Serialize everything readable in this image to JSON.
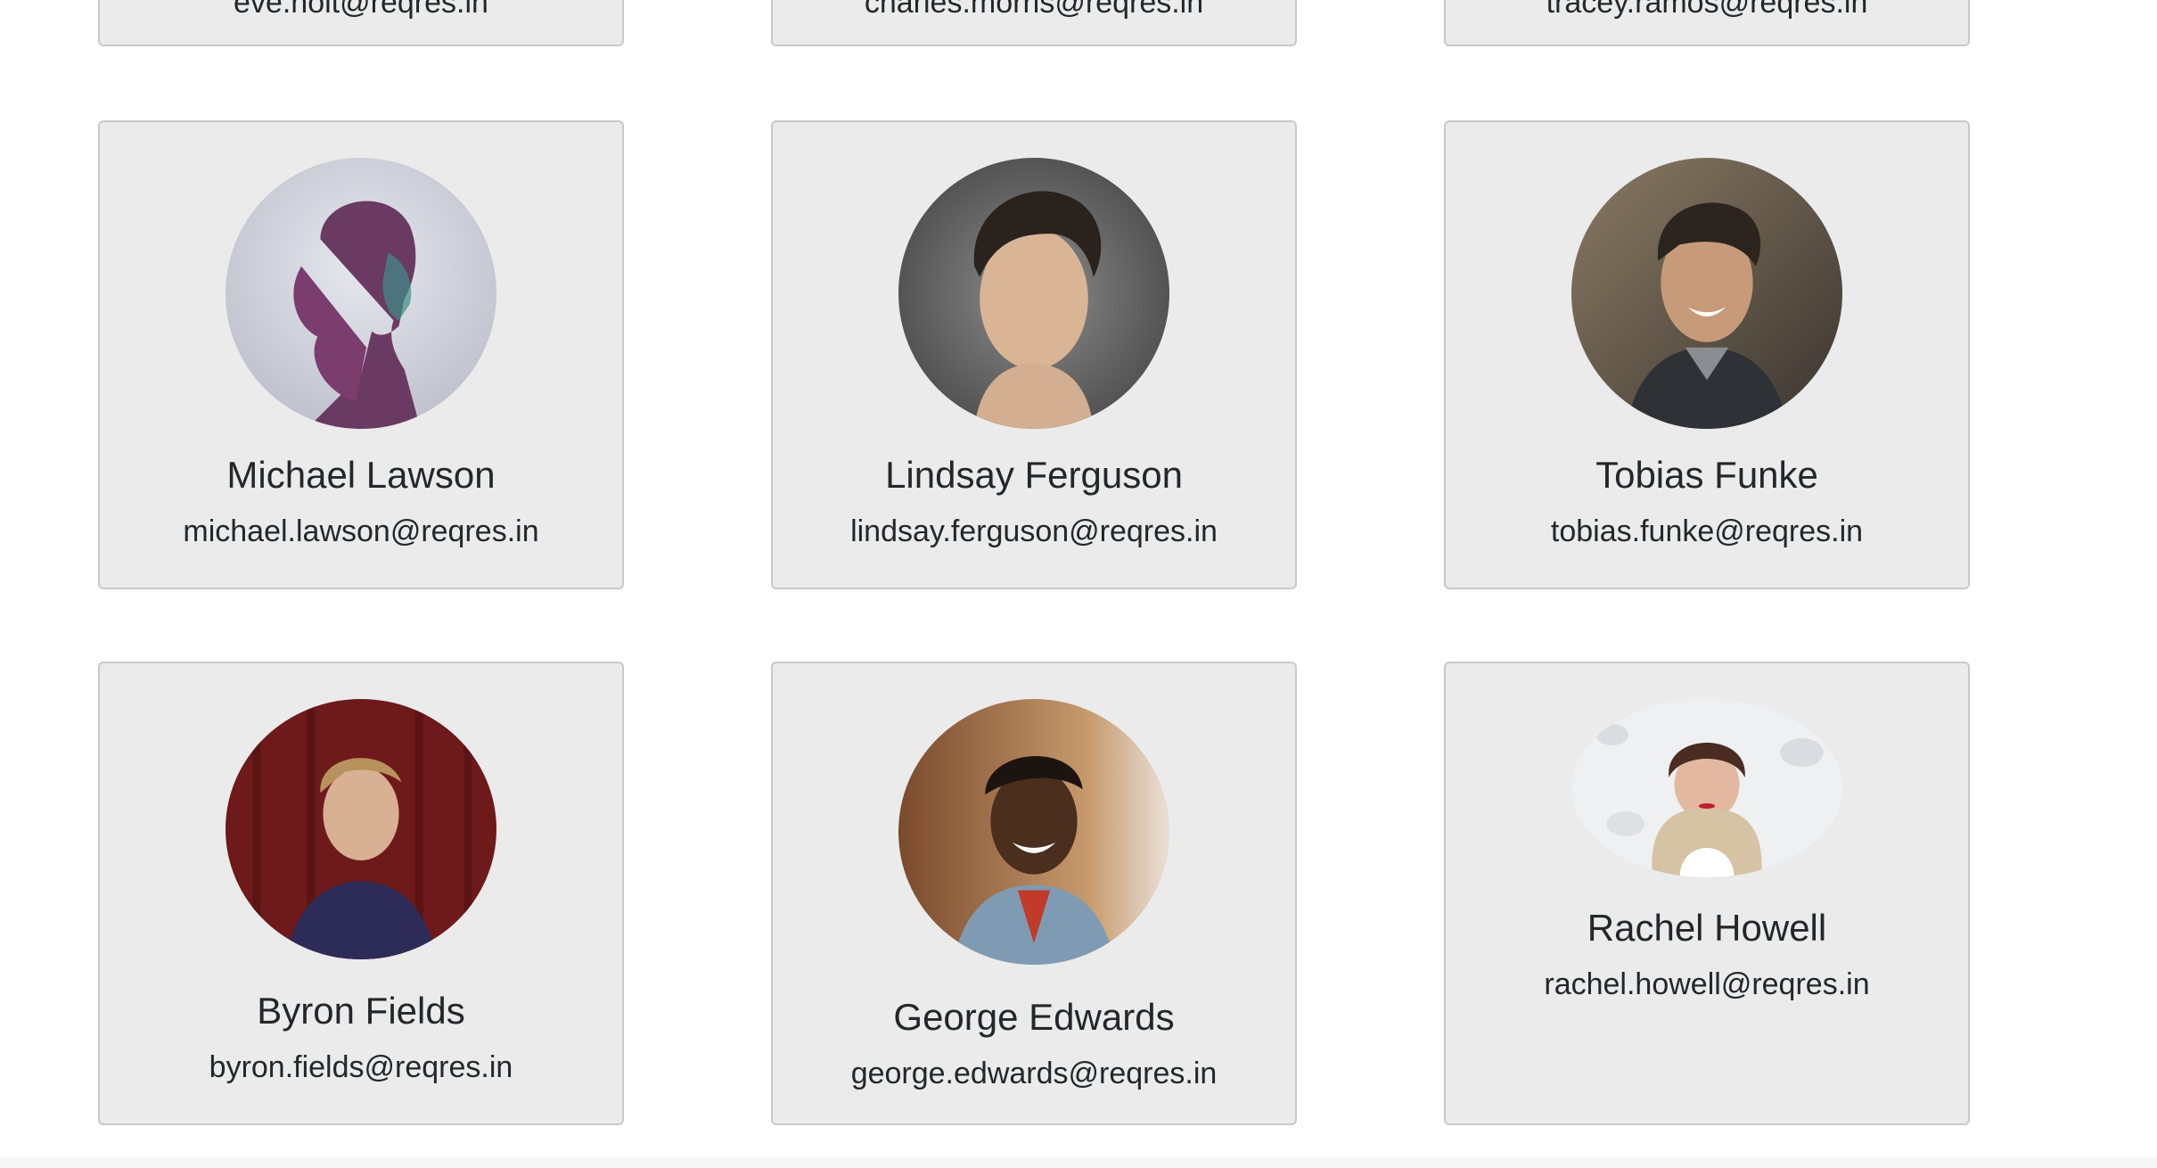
{
  "users_top_row": [
    {
      "email": "eve.holt@reqres.in"
    },
    {
      "email": "charles.morris@reqres.in"
    },
    {
      "email": "tracey.ramos@reqres.in"
    }
  ],
  "users": [
    {
      "name": "Michael Lawson",
      "email": "michael.lawson@reqres.in",
      "avatar_icon": "avatar-woman-purple-profile"
    },
    {
      "name": "Lindsay Ferguson",
      "email": "lindsay.ferguson@reqres.in",
      "avatar_icon": "avatar-young-man-portrait"
    },
    {
      "name": "Tobias Funke",
      "email": "tobias.funke@reqres.in",
      "avatar_icon": "avatar-smiling-man"
    },
    {
      "name": "Byron Fields",
      "email": "byron.fields@reqres.in",
      "avatar_icon": "avatar-man-red-background"
    },
    {
      "name": "George Edwards",
      "email": "george.edwards@reqres.in",
      "avatar_icon": "avatar-man-street"
    },
    {
      "name": "Rachel Howell",
      "email": "rachel.howell@reqres.in",
      "avatar_icon": "avatar-woman-snow"
    }
  ],
  "colors": {
    "card_bg": "#ebebeb",
    "card_border": "#c9c9c9",
    "text": "#23272b"
  }
}
